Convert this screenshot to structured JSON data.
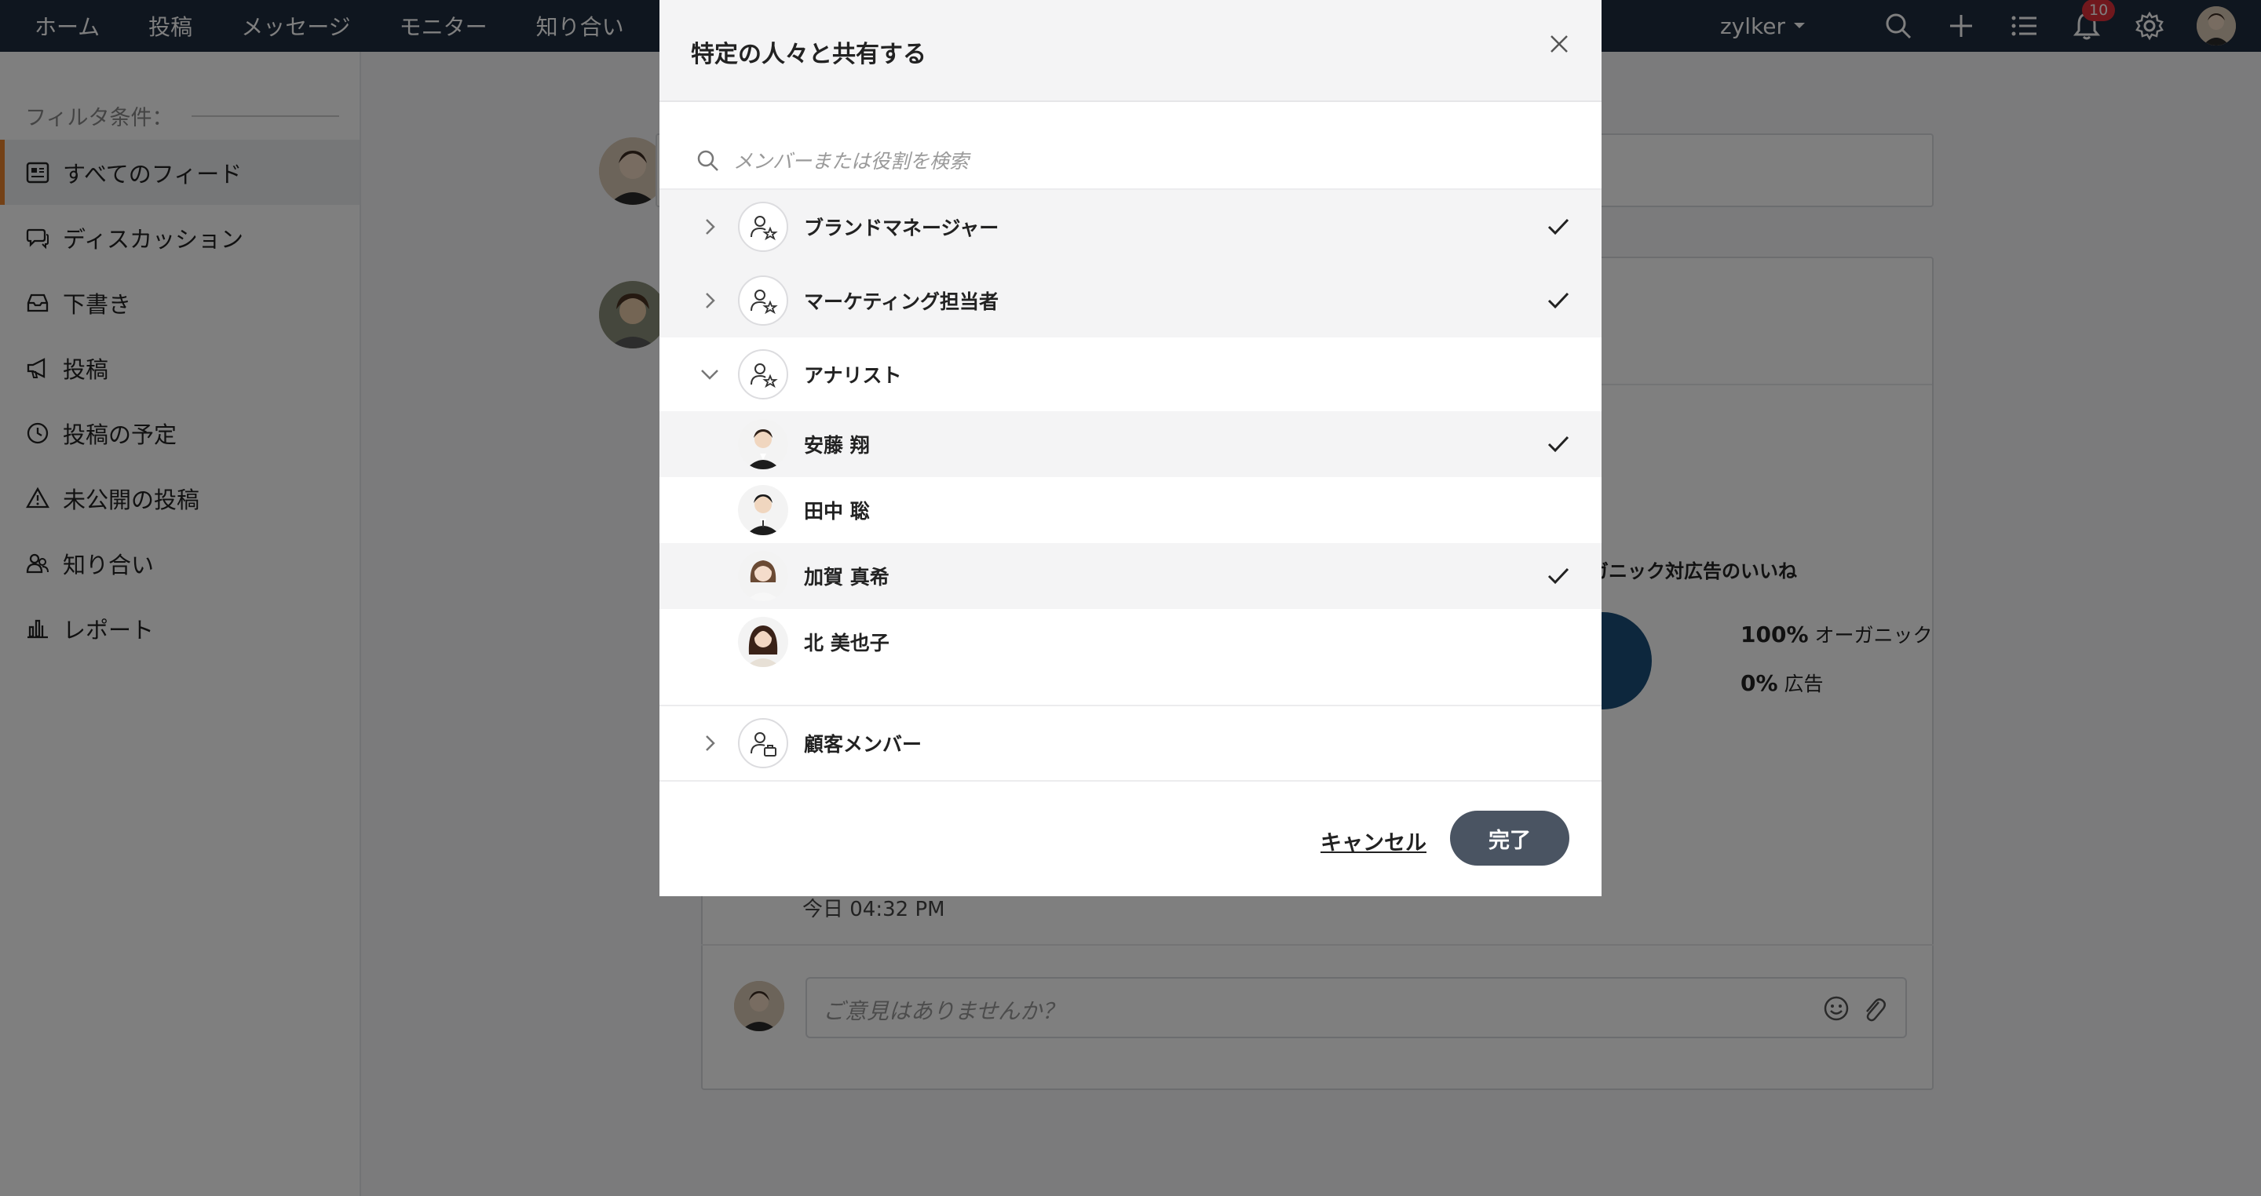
{
  "topbar": {
    "nav": [
      "ホーム",
      "投稿",
      "メッセージ",
      "モニター",
      "知り合い"
    ],
    "org_name": "zylker",
    "notification_count": "10",
    "icons": [
      "search-icon",
      "plus-icon",
      "list-icon",
      "bell-icon",
      "gear-icon"
    ]
  },
  "sidebar": {
    "filter_label": "フィルタ条件：",
    "items": [
      {
        "label": "すべてのフィード",
        "icon": "feed-icon",
        "active": true
      },
      {
        "label": "ディスカッション",
        "icon": "chat-icon"
      },
      {
        "label": "下書き",
        "icon": "tray-icon"
      },
      {
        "label": "投稿",
        "icon": "megaphone-icon"
      },
      {
        "label": "投稿の予定",
        "icon": "clock-icon"
      },
      {
        "label": "未公開の投稿",
        "icon": "warning-icon"
      },
      {
        "label": "知り合い",
        "icon": "people-icon"
      },
      {
        "label": "レポート",
        "icon": "bar-chart-icon"
      }
    ]
  },
  "post": {
    "chart_title": "ガニック対広告のいいね",
    "legend": [
      {
        "value": "100%",
        "label": "オーガニック"
      },
      {
        "value": "0%",
        "label": "広告"
      }
    ],
    "time": "今日 04:32 PM",
    "comment_placeholder": "ご意見はありませんか？"
  },
  "modal": {
    "title": "特定の人々と共有する",
    "search_placeholder": "メンバーまたは役割を検索",
    "groups": [
      {
        "label": "ブランドマネージャー",
        "checked": true,
        "expanded": false
      },
      {
        "label": "マーケティング担当者",
        "checked": true,
        "expanded": false
      },
      {
        "label": "アナリスト",
        "checked": false,
        "expanded": true
      }
    ],
    "members": [
      {
        "name": "安藤 翔",
        "checked": true
      },
      {
        "name": "田中 聡",
        "checked": false
      },
      {
        "name": "加賀 真希",
        "checked": true
      },
      {
        "name": "北 美也子",
        "checked": false
      }
    ],
    "last_group": {
      "label": "顧客メンバー",
      "checked": false,
      "expanded": false
    },
    "cancel_label": "キャンセル",
    "done_label": "完了"
  }
}
